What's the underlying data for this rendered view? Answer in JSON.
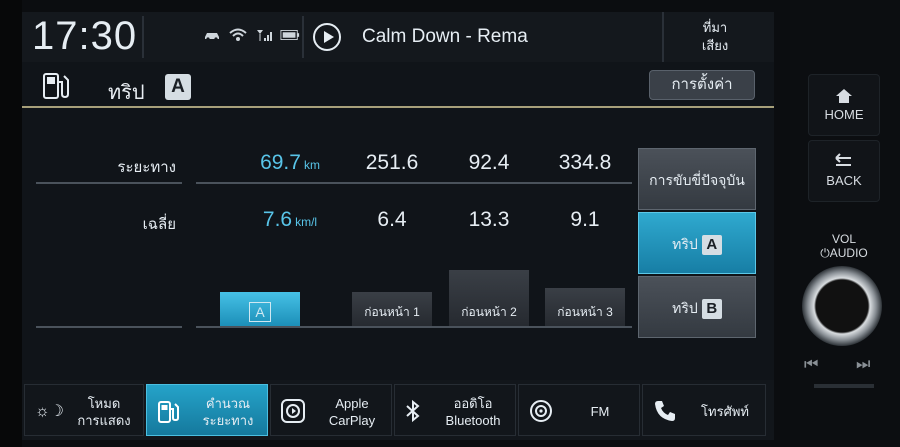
{
  "status": {
    "time": "17:30",
    "now_playing": "Calm Down - Rema",
    "source_label_line1": "ที่มา",
    "source_label_line2": "เสียง"
  },
  "header": {
    "title": "ทริป",
    "trip_badge": "A",
    "settings_label": "การตั้งค่า"
  },
  "table": {
    "row_distance_label": "ระยะทาง",
    "row_avg_label": "เฉลี่ย",
    "distance": {
      "current": "69.7",
      "unit": "km",
      "prev1": "251.6",
      "prev2": "92.4",
      "prev3": "334.8"
    },
    "average": {
      "current": "7.6",
      "unit": "km/l",
      "prev1": "6.4",
      "prev2": "13.3",
      "prev3": "9.1"
    }
  },
  "bars": {
    "current_badge": "A",
    "prev1_label": "ก่อนหน้า 1",
    "prev2_label": "ก่อนหน้า 2",
    "prev3_label": "ก่อนหน้า 3",
    "values": [
      7.6,
      6.4,
      13.3,
      9.1
    ]
  },
  "selector": {
    "current_drive_label": "การขับขี่ปัจจุบัน",
    "trip_a_label": "ทริป",
    "trip_a_badge": "A",
    "trip_b_label": "ทริป",
    "trip_b_badge": "B",
    "active": "trip_a"
  },
  "menu": [
    {
      "line1": "โหมด",
      "line2": "การแสดง",
      "icon": "day-night-icon"
    },
    {
      "line1": "คำนวณ",
      "line2": "ระยะทาง",
      "icon": "fuel-pump-icon",
      "active": true
    },
    {
      "line1": "Apple",
      "line2": "CarPlay",
      "icon": "carplay-icon"
    },
    {
      "line1": "ออดิโอ",
      "line2": "Bluetooth",
      "icon": "bluetooth-icon"
    },
    {
      "line1": "FM",
      "line2": "",
      "icon": "radio-icon"
    },
    {
      "line1": "โทรศัพท์",
      "line2": "",
      "icon": "phone-icon"
    }
  ],
  "hardware": {
    "home_label": "HOME",
    "back_label": "BACK",
    "vol_line1": "VOL",
    "vol_line2": "AUDIO"
  },
  "colors": {
    "accent": "#1c9cc6",
    "current_value": "#58c4e8",
    "header_rule": "#a7a07a"
  }
}
